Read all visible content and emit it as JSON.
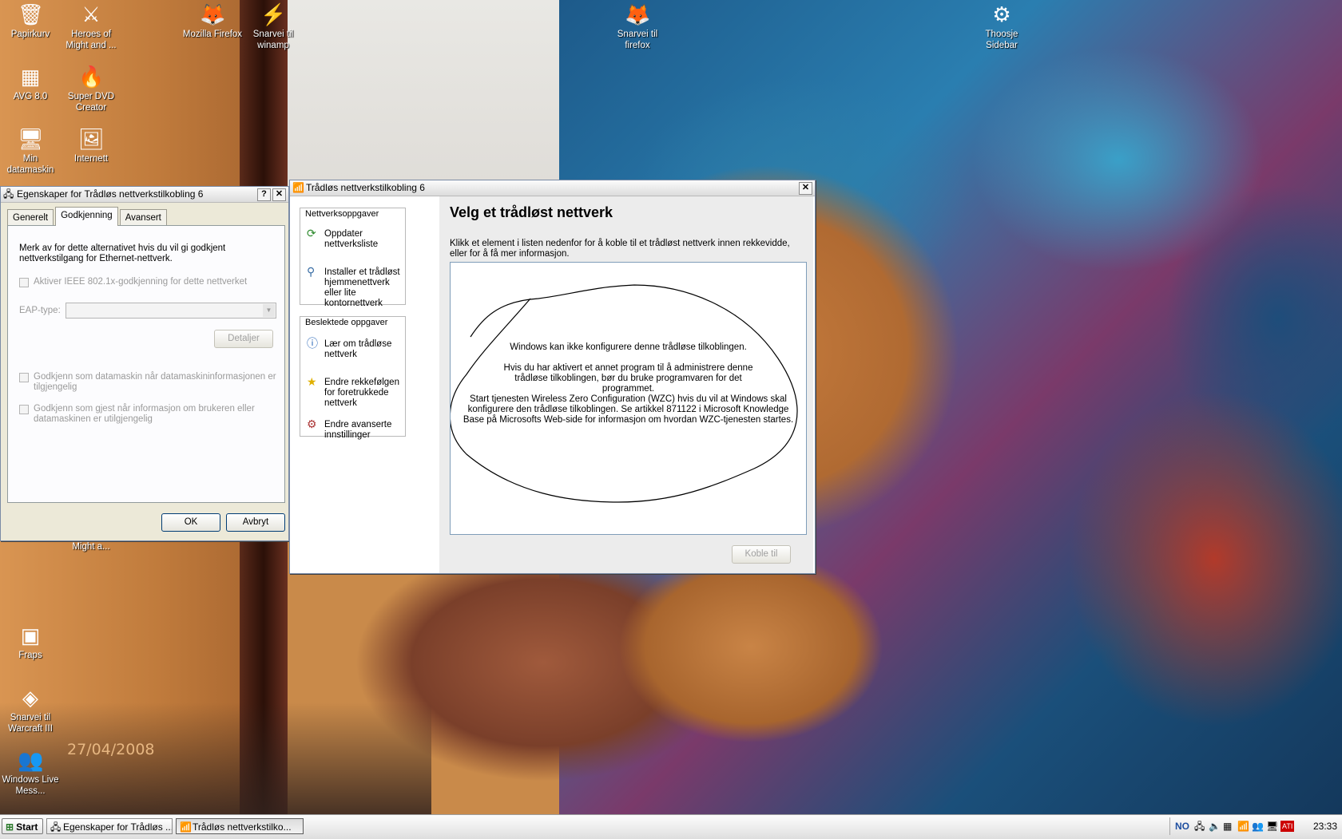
{
  "desktop": {
    "date_stamp": "27/04/2008",
    "icons": [
      {
        "label": "Papirkurv",
        "icon": "recycle-bin-icon",
        "glyph": "🗑"
      },
      {
        "label": "Heroes of Might and ...",
        "icon": "game-icon",
        "glyph": "⚔"
      },
      {
        "label": "Mozilla Firefox",
        "icon": "firefox-icon",
        "glyph": "🦊"
      },
      {
        "label": "Snarvei til winamp",
        "icon": "winamp-icon",
        "glyph": "⚡"
      },
      {
        "label": "Snarvei til firefox",
        "icon": "firefox-shortcut-icon",
        "glyph": "🦊"
      },
      {
        "label": "Thoosje Sidebar",
        "icon": "gear-icon",
        "glyph": "⚙"
      },
      {
        "label": "AVG 8.0",
        "icon": "avg-icon",
        "glyph": "▦"
      },
      {
        "label": "Super DVD Creator",
        "icon": "dvd-icon",
        "glyph": "🔥"
      },
      {
        "label": "Min datamaskin",
        "icon": "my-computer-icon",
        "glyph": "🖥"
      },
      {
        "label": "Internett",
        "icon": "jpeg-file-icon",
        "glyph": "🖼"
      },
      {
        "label": "Might a...",
        "icon": "hidden-icon",
        "glyph": ""
      },
      {
        "label": "Fraps",
        "icon": "fraps-icon",
        "glyph": "▣"
      },
      {
        "label": "Snarvei til Warcraft III",
        "icon": "warcraft-icon",
        "glyph": "◈"
      },
      {
        "label": "Windows Live Mess...",
        "icon": "messenger-icon",
        "glyph": "👥"
      }
    ]
  },
  "props_window": {
    "title": "Egenskaper for Trådløs nettverkstilkobling 6",
    "help_btn": "?",
    "close_btn": "✕",
    "tabs": [
      "Generelt",
      "Godkjenning",
      "Avansert"
    ],
    "description": "Merk av for dette alternativet hvis du vil gi godkjent nettverkstilgang for Ethernet-nettverk.",
    "checkbox_ieee": "Aktiver IEEE 802.1x-godkjenning for dette nettverket",
    "eap_label": "EAP-type:",
    "eap_value": "",
    "details_btn": "Detaljer",
    "checkbox_computer": "Godkjenn som datamaskin når datamaskininformasjonen er tilgjengelig",
    "checkbox_guest": "Godkjenn som gjest når informasjon om brukeren eller datamaskinen er utilgjengelig",
    "ok_btn": "OK",
    "cancel_btn": "Avbryt"
  },
  "wlan_window": {
    "title": "Trådløs nettverkstilkobling 6",
    "close_btn": "✕",
    "network_tasks": {
      "header": "Nettverksoppgaver",
      "items": [
        {
          "label": "Oppdater nettverksliste",
          "icon": "refresh-icon"
        },
        {
          "label": "Installer et trådløst hjemmenettverk eller lite kontornettverk",
          "icon": "wireless-setup-icon"
        }
      ]
    },
    "related_tasks": {
      "header": "Beslektede oppgaver",
      "items": [
        {
          "label": "Lær om trådløse nettverk",
          "icon": "info-icon"
        },
        {
          "label": "Endre rekkefølgen for foretrukkede nettverk",
          "icon": "star-icon"
        },
        {
          "label": "Endre avanserte innstillinger",
          "icon": "settings-icon"
        }
      ]
    },
    "heading": "Velg et trådløst nettverk",
    "instructions": "Klikk et element i listen nedenfor for å koble til et trådløst nettverk innen rekkevidde, eller for å få mer informasjon.",
    "list_messages": {
      "line1": "Windows kan ikke konfigurere denne trådløse tilkoblingen.",
      "line2": "Hvis du har aktivert et annet program til å administrere denne trådløse tilkoblingen, bør du bruke programvaren for det programmet.",
      "line3": "Start tjenesten Wireless Zero Configuration (WZC) hvis du vil at Windows skal konfigurere den trådløse tilkoblingen. Se artikkel 871122 i Microsoft Knowledge Base på Microsofts Web-side for informasjon om hvordan WZC-tjenesten startes."
    },
    "connect_btn": "Koble til"
  },
  "taskbar": {
    "start_label": "Start",
    "items": [
      {
        "label": "Egenskaper for Trådløs ...",
        "active": false
      },
      {
        "label": "Trådløs nettverkstilko...",
        "active": true
      }
    ],
    "tray_lang": "NO",
    "tray_ati": "ATI",
    "clock": "23:33"
  }
}
